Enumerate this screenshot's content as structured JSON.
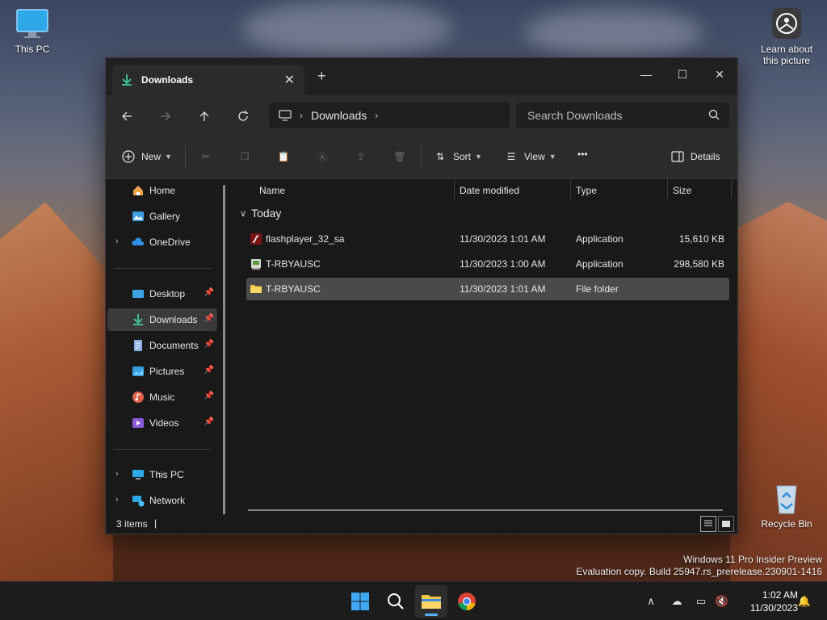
{
  "desktop": {
    "this_pc_label": "This PC",
    "learn_label_1": "Learn about",
    "learn_label_2": "this picture",
    "recycle_label": "Recycle Bin",
    "watermark_line1": "Windows 11 Pro Insider Preview",
    "watermark_line2": "Evaluation copy. Build 25947.rs_prerelease.230901-1416"
  },
  "window": {
    "tab_title": "Downloads",
    "tab_close": "✕",
    "new_tab": "+",
    "minimize": "—",
    "maximize": "☐",
    "close": "✕"
  },
  "nav": {
    "back_icon": "arrow-left-icon",
    "forward_icon": "arrow-right-icon",
    "up_icon": "arrow-up-icon",
    "refresh_icon": "refresh-icon",
    "crumb": "Downloads",
    "search_placeholder": "Search Downloads"
  },
  "commands": {
    "new_label": "New",
    "sort_label": "Sort",
    "view_label": "View",
    "more_label": "•••",
    "details_label": "Details"
  },
  "sidebar": {
    "items": [
      {
        "label": "Home",
        "icon": "home-icon"
      },
      {
        "label": "Gallery",
        "icon": "gallery-icon"
      },
      {
        "label": "OneDrive",
        "icon": "cloud-icon"
      },
      {
        "label": "Desktop",
        "icon": "desktop-icon"
      },
      {
        "label": "Downloads",
        "icon": "download-icon"
      },
      {
        "label": "Documents",
        "icon": "document-icon"
      },
      {
        "label": "Pictures",
        "icon": "pictures-icon"
      },
      {
        "label": "Music",
        "icon": "music-icon"
      },
      {
        "label": "Videos",
        "icon": "video-icon"
      },
      {
        "label": "This PC",
        "icon": "computer-icon"
      },
      {
        "label": "Network",
        "icon": "network-icon"
      }
    ]
  },
  "columns": {
    "name": "Name",
    "date": "Date modified",
    "type": "Type",
    "size": "Size"
  },
  "group": {
    "label": "Today"
  },
  "files": [
    {
      "name": "flashplayer_32_sa",
      "date": "11/30/2023 1:01 AM",
      "type": "Application",
      "size": "15,610 KB",
      "icon": "flash-app-icon"
    },
    {
      "name": "T-RBYAUSC",
      "date": "11/30/2023 1:00 AM",
      "type": "Application",
      "size": "298,580 KB",
      "icon": "installer-app-icon"
    },
    {
      "name": "T-RBYAUSC",
      "date": "11/30/2023 1:01 AM",
      "type": "File folder",
      "size": "",
      "icon": "folder-icon"
    }
  ],
  "status": {
    "count": "3 items",
    "caret": "|"
  },
  "taskbar": {
    "time": "1:02 AM",
    "date": "11/30/2023"
  },
  "colors": {
    "accent": "#5ab0ff",
    "folder": "#f5c542",
    "download_green": "#3fbf8f"
  }
}
